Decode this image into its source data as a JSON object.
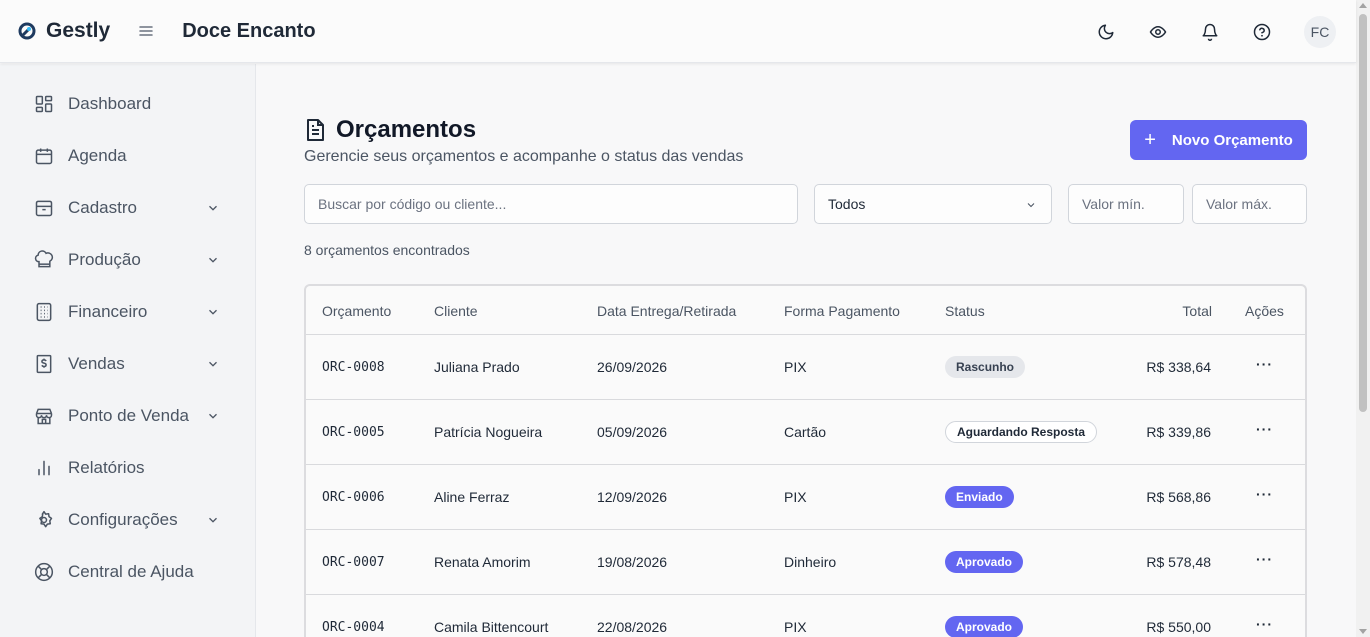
{
  "header": {
    "brand": "Gestly",
    "org": "Doce Encanto",
    "avatar": "FC"
  },
  "sidebar": {
    "items": [
      {
        "label": "Dashboard",
        "icon": "dashboard-icon",
        "expandable": false
      },
      {
        "label": "Agenda",
        "icon": "calendar-icon",
        "expandable": false
      },
      {
        "label": "Cadastro",
        "icon": "box-icon",
        "expandable": true
      },
      {
        "label": "Produção",
        "icon": "chef-hat-icon",
        "expandable": true
      },
      {
        "label": "Financeiro",
        "icon": "building-icon",
        "expandable": true
      },
      {
        "label": "Vendas",
        "icon": "receipt-dollar-icon",
        "expandable": true
      },
      {
        "label": "Ponto de Venda",
        "icon": "store-icon",
        "expandable": true
      },
      {
        "label": "Relatórios",
        "icon": "bar-chart-icon",
        "expandable": false
      },
      {
        "label": "Configurações",
        "icon": "gear-icon",
        "expandable": true
      },
      {
        "label": "Central de Ajuda",
        "icon": "lifebuoy-icon",
        "expandable": false
      }
    ]
  },
  "page": {
    "title": "Orçamentos",
    "subtitle": "Gerencie seus orçamentos e acompanhe o status das vendas",
    "new_button": "Novo Orçamento",
    "new_button_icon": "+",
    "search_placeholder": "Buscar por código ou cliente...",
    "status_filter": "Todos",
    "min_placeholder": "Valor mín.",
    "max_placeholder": "Valor máx.",
    "count_text": "8 orçamentos encontrados"
  },
  "table": {
    "columns": [
      "Orçamento",
      "Cliente",
      "Data Entrega/Retirada",
      "Forma Pagamento",
      "Status",
      "Total",
      "Ações"
    ],
    "rows": [
      {
        "code": "ORC-0008",
        "client": "Juliana Prado",
        "date": "26/09/2026",
        "payment": "PIX",
        "status": "Rascunho",
        "status_kind": "draft",
        "total": "R$ 338,64",
        "actions": "···"
      },
      {
        "code": "ORC-0005",
        "client": "Patrícia Nogueira",
        "date": "05/09/2026",
        "payment": "Cartão",
        "status": "Aguardando Resposta",
        "status_kind": "wait",
        "total": "R$ 339,86",
        "actions": "···"
      },
      {
        "code": "ORC-0006",
        "client": "Aline Ferraz",
        "date": "12/09/2026",
        "payment": "PIX",
        "status": "Enviado",
        "status_kind": "sent",
        "total": "R$ 568,86",
        "actions": "···"
      },
      {
        "code": "ORC-0007",
        "client": "Renata Amorim",
        "date": "19/08/2026",
        "payment": "Dinheiro",
        "status": "Aprovado",
        "status_kind": "ok",
        "total": "R$ 578,48",
        "actions": "···"
      },
      {
        "code": "ORC-0004",
        "client": "Camila Bittencourt",
        "date": "22/08/2026",
        "payment": "PIX",
        "status": "Aprovado",
        "status_kind": "ok",
        "total": "R$ 550,00",
        "actions": "···"
      }
    ]
  },
  "colors": {
    "accent": "#6366f1",
    "sidebar_bg": "#f3f4f6"
  }
}
